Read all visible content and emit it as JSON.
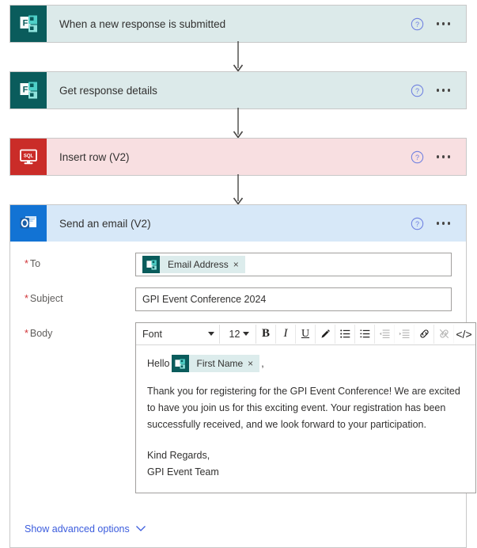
{
  "flow": {
    "steps": [
      {
        "id": "trigger",
        "title": "When a new response is submitted",
        "connector": "Microsoft Forms",
        "icon": "forms-icon",
        "tint": "#dceaea",
        "tile": "#0a5c5c",
        "help_icon": "help-icon",
        "menu_icon": "ellipsis-icon",
        "expanded": false
      },
      {
        "id": "get-response",
        "title": "Get response details",
        "connector": "Microsoft Forms",
        "icon": "forms-icon",
        "tint": "#dceaea",
        "tile": "#0a5c5c",
        "help_icon": "help-icon",
        "menu_icon": "ellipsis-icon",
        "expanded": false
      },
      {
        "id": "insert-row",
        "title": "Insert row (V2)",
        "connector": "SQL Server",
        "icon": "sql-icon",
        "tint": "#f8dfe1",
        "tile": "#ca2c28",
        "help_icon": "help-icon",
        "menu_icon": "ellipsis-icon",
        "expanded": false
      },
      {
        "id": "send-email",
        "title": "Send an email (V2)",
        "connector": "Office 365 Outlook",
        "icon": "outlook-icon",
        "tint": "#d7e8f8",
        "tile": "#1273d4",
        "help_icon": "help-icon",
        "menu_icon": "ellipsis-icon",
        "expanded": true
      }
    ]
  },
  "email_form": {
    "to": {
      "label": "To",
      "required_marker": "*",
      "token": {
        "label": "Email Address",
        "icon": "forms-token-icon",
        "remove_label": "×"
      }
    },
    "subject": {
      "label": "Subject",
      "required_marker": "*",
      "value": "GPI Event Conference 2024"
    },
    "body": {
      "label": "Body",
      "required_marker": "*",
      "toolbar": {
        "font_label": "Font",
        "font_size": "12",
        "buttons": [
          {
            "name": "bold-button",
            "glyph": "B",
            "disabled": false
          },
          {
            "name": "italic-button",
            "glyph": "I",
            "disabled": false
          },
          {
            "name": "underline-button",
            "glyph": "U",
            "disabled": false
          },
          {
            "name": "text-color-button",
            "glyph": "pen",
            "disabled": false
          },
          {
            "name": "bulleted-list-button",
            "glyph": "bullets",
            "disabled": false
          },
          {
            "name": "numbered-list-button",
            "glyph": "numbers",
            "disabled": false
          },
          {
            "name": "decrease-indent-button",
            "glyph": "outdent",
            "disabled": true
          },
          {
            "name": "increase-indent-button",
            "glyph": "indent",
            "disabled": true
          },
          {
            "name": "insert-link-button",
            "glyph": "link",
            "disabled": false
          },
          {
            "name": "remove-link-button",
            "glyph": "unlink",
            "disabled": true
          },
          {
            "name": "code-view-button",
            "glyph": "</>",
            "disabled": false
          }
        ]
      },
      "content": {
        "greeting_prefix": "Hello",
        "greeting_token": {
          "label": "First Name",
          "icon": "forms-token-icon",
          "remove_label": "×"
        },
        "greeting_suffix": ",",
        "paragraph": "Thank you for registering for the GPI Event Conference! We are excited to have you join us for this exciting event. Your registration has been successfully received, and we look forward to your participation.",
        "signoff": "Kind Regards,",
        "signature": "GPI Event Team"
      }
    },
    "advanced_options": {
      "label": "Show advanced options",
      "chevron": "chevron-down-icon"
    }
  }
}
